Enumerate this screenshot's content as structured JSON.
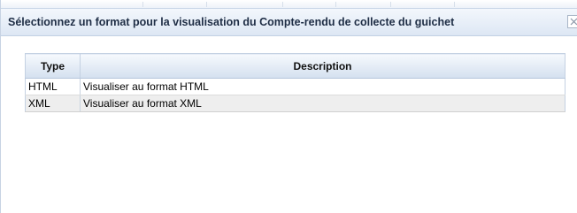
{
  "dialog": {
    "title": "Sélectionnez un format pour la visualisation du Compte-rendu de collecte du guichet",
    "close_icon": "close-icon"
  },
  "table": {
    "headers": {
      "type": "Type",
      "description": "Description"
    },
    "rows": [
      {
        "type": "HTML",
        "description": "Visualiser au format HTML"
      },
      {
        "type": "XML",
        "description": "Visualiser au format XML"
      }
    ]
  }
}
